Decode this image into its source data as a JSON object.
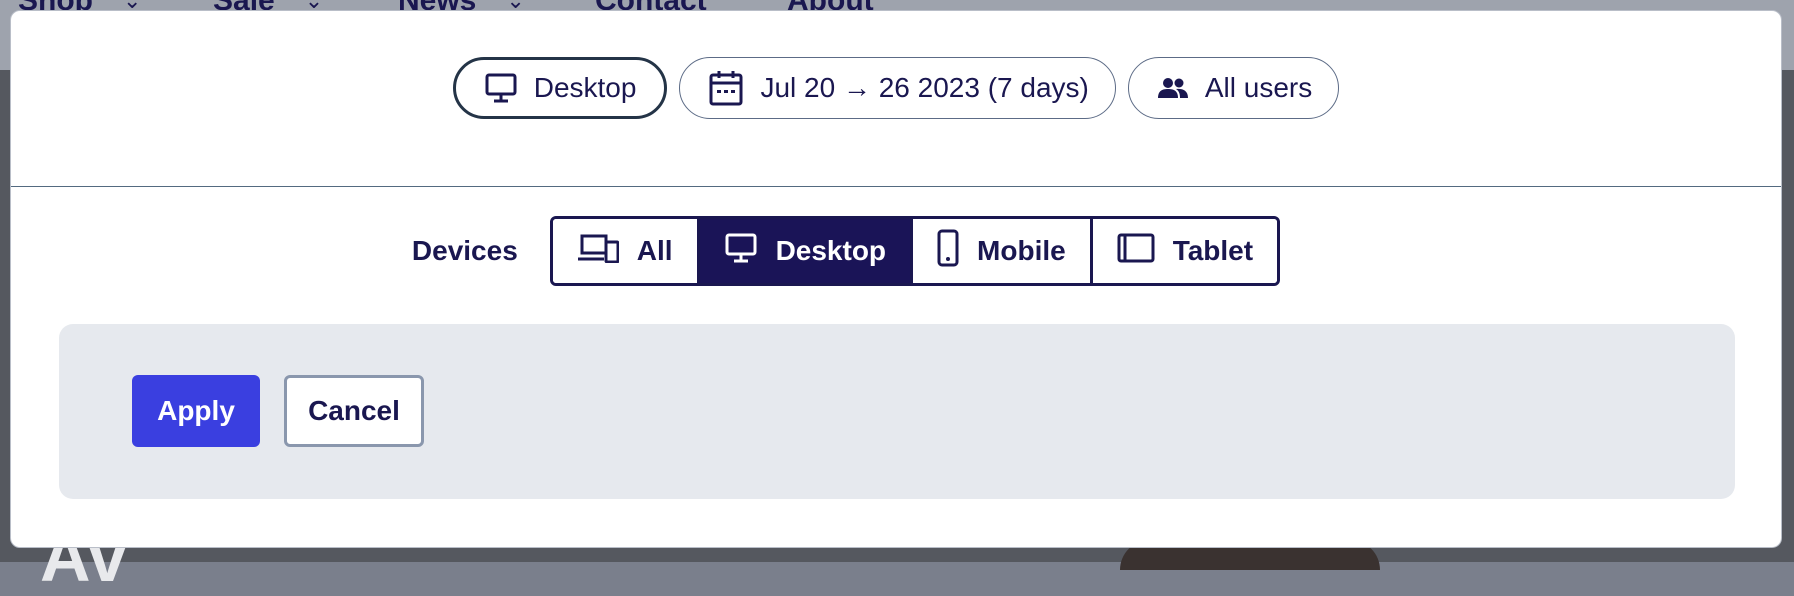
{
  "background_nav": {
    "items": [
      "Shop",
      "Sale",
      "News",
      "Contact",
      "About"
    ]
  },
  "background_hero": {
    "text": "Av"
  },
  "filters": {
    "device_chip": {
      "label": "Desktop",
      "icon": "monitor-icon"
    },
    "date_chip": {
      "label": "Jul 20 → 26 2023 (7 days)",
      "icon": "calendar-icon"
    },
    "users_chip": {
      "label": "All users",
      "icon": "users-icon"
    }
  },
  "devices": {
    "label": "Devices",
    "options": [
      {
        "label": "All",
        "icon": "devices-icon",
        "selected": false
      },
      {
        "label": "Desktop",
        "icon": "monitor-icon",
        "selected": true
      },
      {
        "label": "Mobile",
        "icon": "mobile-icon",
        "selected": false
      },
      {
        "label": "Tablet",
        "icon": "tablet-icon",
        "selected": false
      }
    ]
  },
  "actions": {
    "apply_label": "Apply",
    "cancel_label": "Cancel"
  },
  "colors": {
    "primary": "#3a3fe0",
    "navy": "#1a1750",
    "selected_segment": "#1a1457",
    "panel_bg": "#e6e9ee"
  }
}
